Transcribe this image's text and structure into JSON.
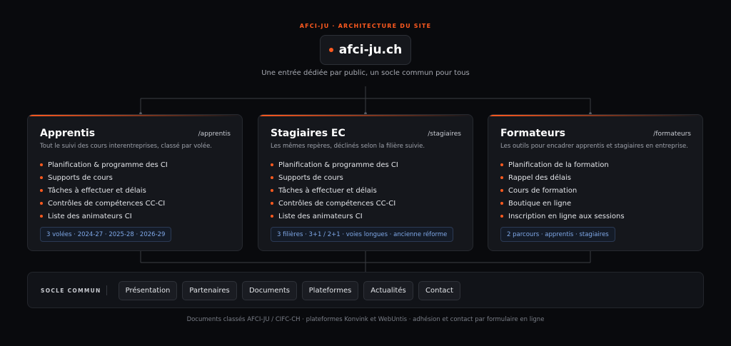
{
  "header": {
    "eyebrow": "AFCI-JU · ARCHITECTURE DU SITE",
    "site_name": "afci-ju.ch",
    "tagline": "Une entrée dédiée par public, un socle commun pour tous"
  },
  "sections": [
    {
      "title": "Apprentis",
      "path": "/apprentis",
      "description": "Tout le suivi des cours interentreprises, classé par volée.",
      "items": [
        "Planification & programme des CI",
        "Supports de cours",
        "Tâches à effectuer et délais",
        "Contrôles de compétences CC-CI",
        "Liste des animateurs CI"
      ],
      "tags": "3 volées · 2024-27 · 2025-28 · 2026-29"
    },
    {
      "title": "Stagiaires EC",
      "path": "/stagiaires",
      "description": "Les mêmes repères, déclinés selon la filière suivie.",
      "items": [
        "Planification & programme des CI",
        "Supports de cours",
        "Tâches à effectuer et délais",
        "Contrôles de compétences CC-CI",
        "Liste des animateurs CI"
      ],
      "tags": "3 filières · 3+1 / 2+1 · voies longues · ancienne réforme"
    },
    {
      "title": "Formateurs",
      "path": "/formateurs",
      "description": "Les outils pour encadrer apprentis et stagiaires en entreprise.",
      "items": [
        "Planification de la formation",
        "Rappel des délais",
        "Cours de formation",
        "Boutique en ligne",
        "Inscription en ligne aux sessions"
      ],
      "tags": "2 parcours · apprentis · stagiaires"
    }
  ],
  "base": {
    "label": "SOCLE COMMUN",
    "links": [
      "Présentation",
      "Partenaires",
      "Documents",
      "Plateformes",
      "Actualités",
      "Contact"
    ]
  },
  "footer": "Documents classés AFCI-JU / CIFC-CH · plateformes Konvink et WebUntis · adhésion et contact par formulaire en ligne",
  "colors": {
    "accent": "#ff5a1f",
    "background": "#090a0d",
    "card": "#15171c",
    "tag_text": "#7fa8e8"
  }
}
